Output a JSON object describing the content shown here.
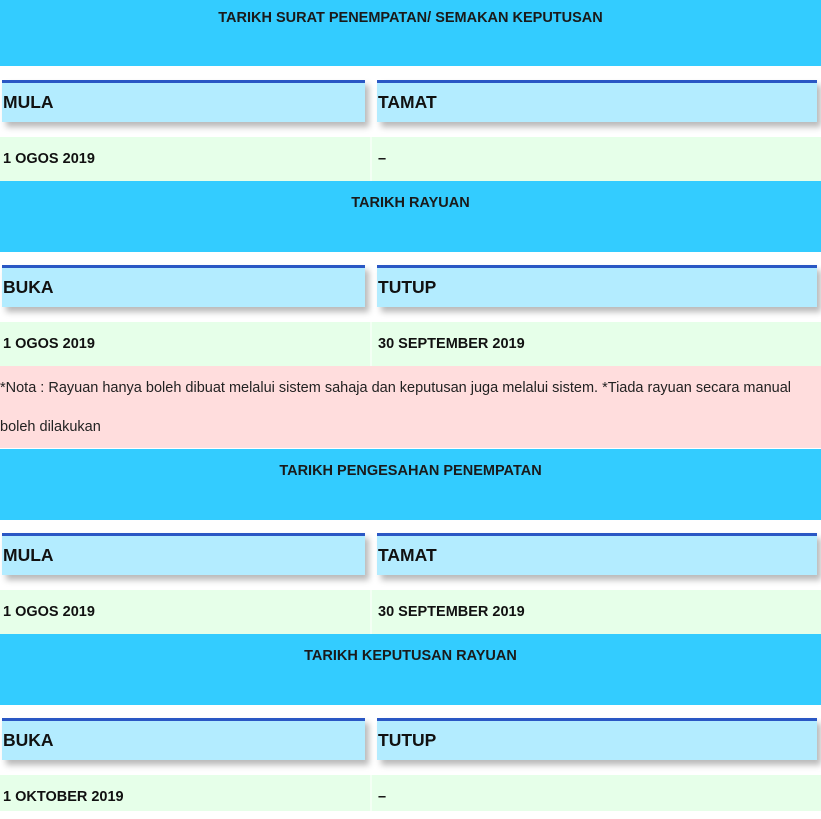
{
  "sections": [
    {
      "title": "TARIKH SURAT PENEMPATAN/ SEMAKAN KEPUTUSAN",
      "columns": [
        "MULA",
        "TAMAT"
      ],
      "values": [
        "1 OGOS 2019",
        "–"
      ]
    },
    {
      "title": "TARIKH RAYUAN",
      "columns": [
        "BUKA",
        "TUTUP"
      ],
      "values": [
        "1 OGOS 2019",
        "30 SEPTEMBER 2019"
      ]
    },
    {
      "title": "TARIKH PENGESAHAN PENEMPATAN",
      "columns": [
        "MULA",
        "TAMAT"
      ],
      "values": [
        "1 OGOS 2019",
        "30 SEPTEMBER 2019"
      ]
    },
    {
      "title": "TARIKH KEPUTUSAN RAYUAN",
      "columns": [
        "BUKA",
        "TUTUP"
      ],
      "values": [
        "1 OKTOBER 2019",
        "–"
      ]
    }
  ],
  "note": "*Nota :  Rayuan hanya boleh dibuat melalui sistem sahaja dan keputusan juga melalui sistem. *Tiada rayuan secara manual boleh dilakukan",
  "colors": {
    "header_bg": "#33ccff",
    "column_header_bg": "#b3ecff",
    "column_header_border": "#2a57c4",
    "value_row_bg": "#e6ffe9",
    "note_bg": "#ffdddd"
  }
}
